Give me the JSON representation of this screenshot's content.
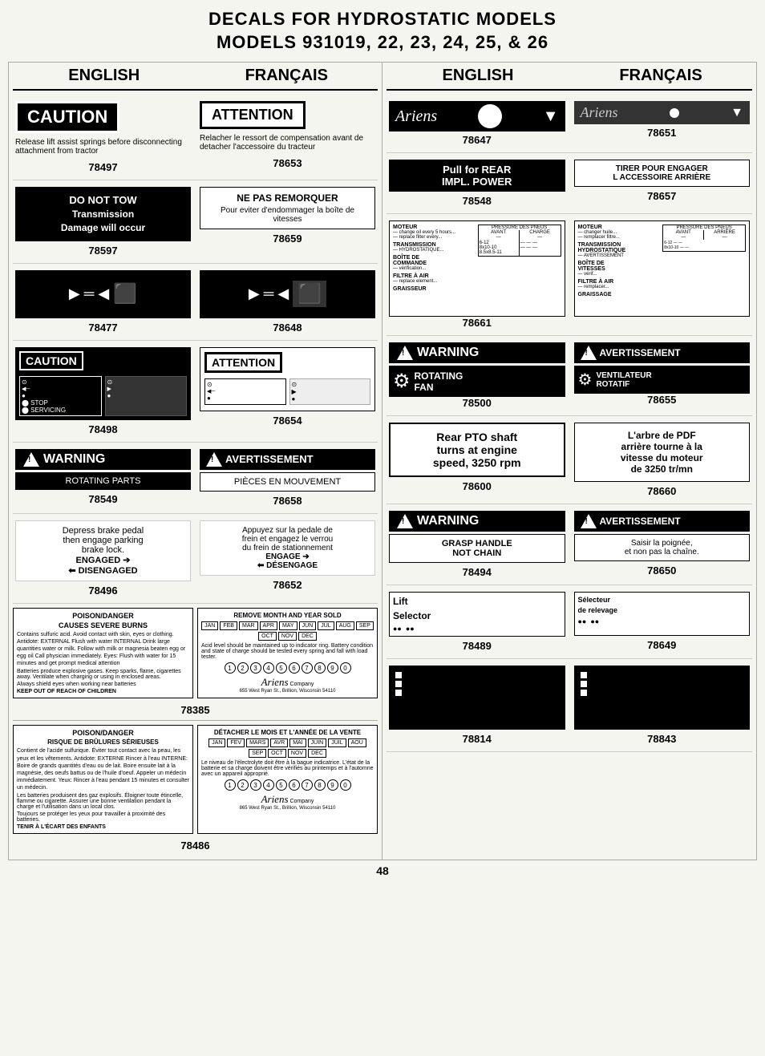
{
  "page": {
    "title_line1": "DECALS FOR HYDROSTATIC MODELS",
    "title_line2": "MODELS 931019, 22, 23, 24, 25, & 26"
  },
  "left_panel": {
    "header": {
      "col1": "ENGLISH",
      "col2": "FRANÇAIS"
    },
    "sections": [
      {
        "en_num": "78497",
        "fr_num": "78653",
        "en_label": "CAUTION",
        "fr_label": "ATTENTION",
        "en_text": "Release lift assist springs before disconnecting attachment from tractor",
        "fr_text": "Relacher le ressort de compensation avant de detacher l'accessoire du tracteur"
      },
      {
        "en_num": "78597",
        "fr_num": "78659",
        "en_label": "DO NOT TOW",
        "en_text2": "Transmission\nDamage will occur",
        "fr_label": "NE PAS REMORQUER",
        "fr_text": "Pour eviter d'endommager la boîte de vitesses"
      },
      {
        "en_num": "78477",
        "fr_num": "78648",
        "en_type": "gear_diagram",
        "fr_type": "gear_diagram"
      },
      {
        "en_num": "78498",
        "fr_num": "78654",
        "en_label": "CAUTION",
        "fr_label": "ATTENTION",
        "en_type": "gauge",
        "fr_type": "gauge"
      },
      {
        "en_num": "78549",
        "fr_num": "78658",
        "en_label": "WARNING",
        "fr_label": "AVERTISSEMENT",
        "en_text": "ROTATING PARTS",
        "fr_text": "PIÈCES EN MOUVEMENT"
      },
      {
        "en_num": "78496",
        "fr_num": "78652",
        "en_type": "brake",
        "fr_type": "brake",
        "en_text": "Depress brake pedal then engage parking brake lock.\nENGAGED ➔\n⬅ DISENGAGED",
        "fr_text": "Appuyez sur la pedale de frein et engagez le verrou du frein de stationnement\nENGAGE ➔\n⬅ DÉSENGAGE"
      }
    ],
    "bottom_section": {
      "num_78385": "78385",
      "num_78486": "78486"
    }
  },
  "right_panel": {
    "header": {
      "col1": "ENGLISH",
      "col2": "FRANÇAIS"
    },
    "sections": [
      {
        "en_num": "78647",
        "fr_num": "78651",
        "en_type": "ariens_logo",
        "fr_type": "ariens_logo"
      },
      {
        "en_num": "78548",
        "fr_num": "78657",
        "en_text": "Pull for REAR IMPL. POWER",
        "fr_text": "TIRER POUR ENGAGER L ACCESSOIRE ARRIÈRE"
      },
      {
        "en_num": "78661",
        "fr_num": "78661",
        "en_type": "maintenance_table",
        "fr_type": "maintenance_table",
        "single_item": true
      },
      {
        "en_num": "78500",
        "fr_num": "78655",
        "en_label": "WARNING",
        "fr_label": "AVERTISSEMENT",
        "en_text": "ROTATING FAN",
        "fr_text": "VENTILATEUR ROTATIF"
      },
      {
        "en_num": "78600",
        "fr_num": "78660",
        "en_text": "Rear PTO shaft turns at engine speed, 3250 rpm",
        "fr_text": "L'arbre de PDF arrière tourne à la vitesse du moteur de 3250 tr/mn"
      },
      {
        "en_num": "78494",
        "fr_num": "78650",
        "en_label": "WARNING",
        "fr_label": "AVERTISSEMENT",
        "en_text": "GRASP HANDLE NOT CHAIN",
        "fr_text": "Saisir la poignée, et non pas la chaîne."
      },
      {
        "en_num": "78489",
        "fr_num": "78649",
        "en_type": "lift_selector",
        "fr_type": "lift_selector",
        "en_text": "Lift Selector",
        "fr_text": "Sélecteur de relevage"
      },
      {
        "en_num": "78814",
        "fr_num": "78843",
        "en_type": "small_black",
        "fr_type": "small_black"
      }
    ]
  },
  "page_number": "48"
}
